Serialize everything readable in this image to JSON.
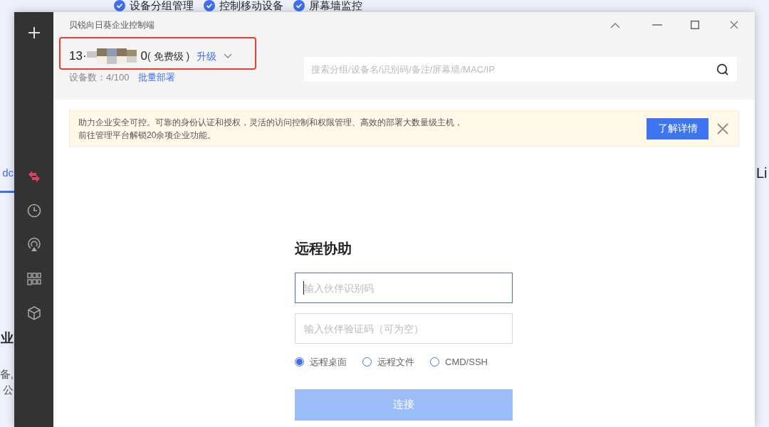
{
  "background_page": {
    "features": [
      "设备分组管理",
      "控制移动设备",
      "屏幕墙监控"
    ],
    "left_fragments": [
      "dc",
      "业",
      "备,",
      "公"
    ],
    "right_fragments": [
      "Li"
    ]
  },
  "window": {
    "title": "贝锐向日葵企业控制端"
  },
  "sidebar": {
    "items": [
      {
        "kind": "add",
        "selected": false
      },
      {
        "kind": "remote",
        "selected": true
      },
      {
        "kind": "history",
        "selected": false
      },
      {
        "kind": "cast",
        "selected": false
      },
      {
        "kind": "apps",
        "selected": false
      },
      {
        "kind": "box",
        "selected": false
      }
    ]
  },
  "account": {
    "id_start": "13·",
    "id_end": "0",
    "plan": "( 免费级 )",
    "upgrade": "升级",
    "device_count": "设备数：4/100",
    "deploy_link": "批量部署",
    "highlighted": true
  },
  "search": {
    "placeholder": "搜索分组/设备名/识别码/备注/屏幕墙/MAC/IP"
  },
  "banner": {
    "text": "助力企业安全可控。可靠的身份认证和授权，灵活的访问控制和权限管理、高效的部署大数量级主机，前往管理平台解锁20余项企业功能。",
    "button": "了解详情"
  },
  "remote_assist": {
    "title": "远程协助",
    "fields": [
      {
        "placeholder": "输入伙伴识别码",
        "focused": true
      },
      {
        "placeholder": "输入伙伴验证码（可为空）",
        "focused": false
      }
    ],
    "modes": [
      {
        "label": "远程桌面",
        "selected": true
      },
      {
        "label": "远程文件",
        "selected": false
      },
      {
        "label": "CMD/SSH",
        "selected": false
      }
    ],
    "connect": "连接"
  }
}
